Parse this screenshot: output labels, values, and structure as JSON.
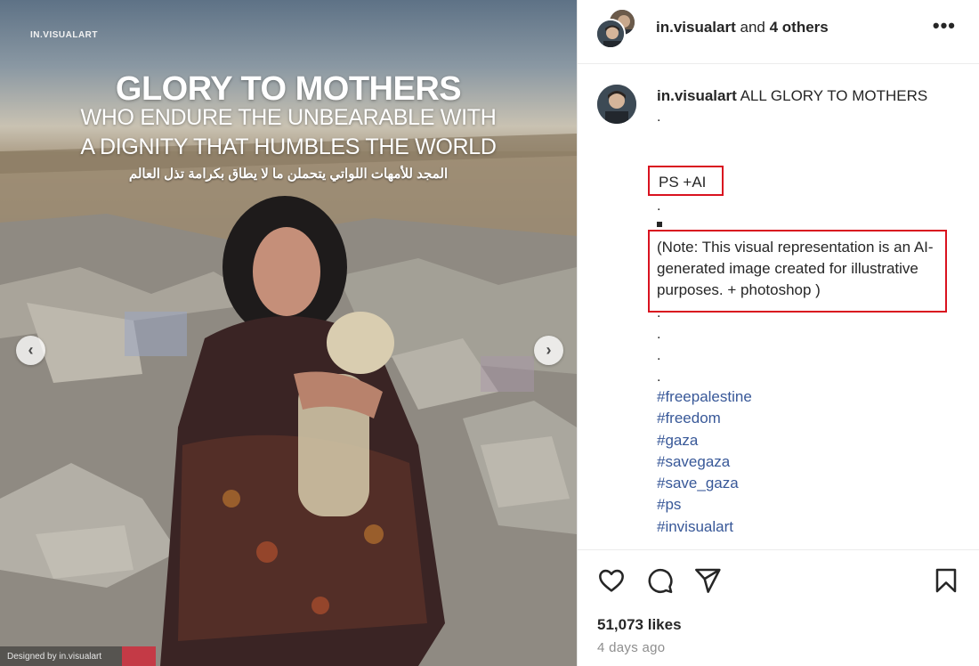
{
  "post_image": {
    "brand_tag": "IN.VISUALART",
    "headline_main": "GLORY TO MOTHERS",
    "headline_line2": "WHO ENDURE THE UNBEARABLE WITH",
    "headline_line3": "A DIGNITY THAT HUMBLES THE WORLD",
    "headline_arabic": "المجد للأمهات اللواتي يتحملن ما لا يطاق بكرامة تذل العالم",
    "credit": "Designed by in.visualart",
    "prev_icon": "chevron-left-icon",
    "next_icon": "chevron-right-icon"
  },
  "header": {
    "username": "in.visualart",
    "connector": "and",
    "others": "4 others",
    "more_icon": "more-horizontal-icon",
    "more_label": "•••"
  },
  "caption": {
    "username": "in.visualart",
    "text": "ALL GLORY TO MOTHERS",
    "dot": ".",
    "ps_label": "PS +AI",
    "note": "(Note: This visual representation is an AI-generated image created for illustrative purposes. + photoshop )",
    "hashtags": [
      "#freepalestine",
      "#freedom",
      "#gaza",
      "#savegaza",
      "#save_gaza",
      "#ps",
      "#invisualart"
    ]
  },
  "actions": {
    "like_icon": "heart-icon",
    "comment_icon": "comment-icon",
    "share_icon": "send-icon",
    "save_icon": "bookmark-icon"
  },
  "likes": "51,073 likes",
  "date": "4 days ago",
  "colors": {
    "annotation_box": "#d9121f",
    "hashtag": "#385898",
    "muted_text": "#8e8e8e"
  }
}
